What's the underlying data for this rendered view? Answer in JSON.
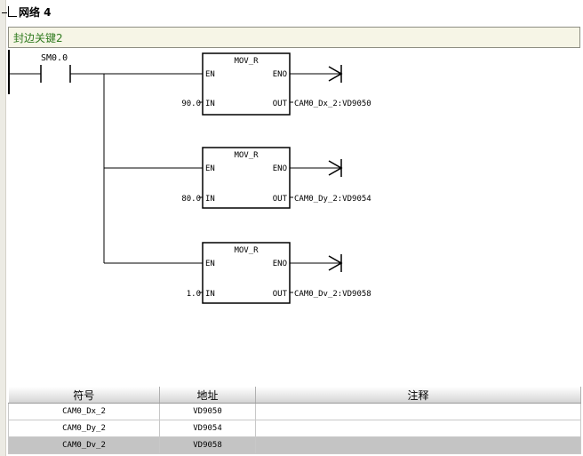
{
  "network": {
    "title": "网络 4",
    "comment": "封边关键2"
  },
  "contact": {
    "label": "SM0.0"
  },
  "blocks": [
    {
      "name": "MOV_R",
      "en": "EN",
      "eno": "ENO",
      "in_label": "IN",
      "out_label": "OUT",
      "in_value": "90.0",
      "out_value": "CAM0_Dx_2:VD9050"
    },
    {
      "name": "MOV_R",
      "en": "EN",
      "eno": "ENO",
      "in_label": "IN",
      "out_label": "OUT",
      "in_value": "80.0",
      "out_value": "CAM0_Dy_2:VD9054"
    },
    {
      "name": "MOV_R",
      "en": "EN",
      "eno": "ENO",
      "in_label": "IN",
      "out_label": "OUT",
      "in_value": "1.0",
      "out_value": "CAM0_Dv_2:VD9058"
    }
  ],
  "symbol_table": {
    "headers": [
      "符号",
      "地址",
      "注释"
    ],
    "rows": [
      {
        "symbol": "CAM0_Dx_2",
        "address": "VD9050",
        "comment": ""
      },
      {
        "symbol": "CAM0_Dy_2",
        "address": "VD9054",
        "comment": ""
      },
      {
        "symbol": "CAM0_Dv_2",
        "address": "VD9058",
        "comment": ""
      }
    ],
    "selected_row": 2
  }
}
